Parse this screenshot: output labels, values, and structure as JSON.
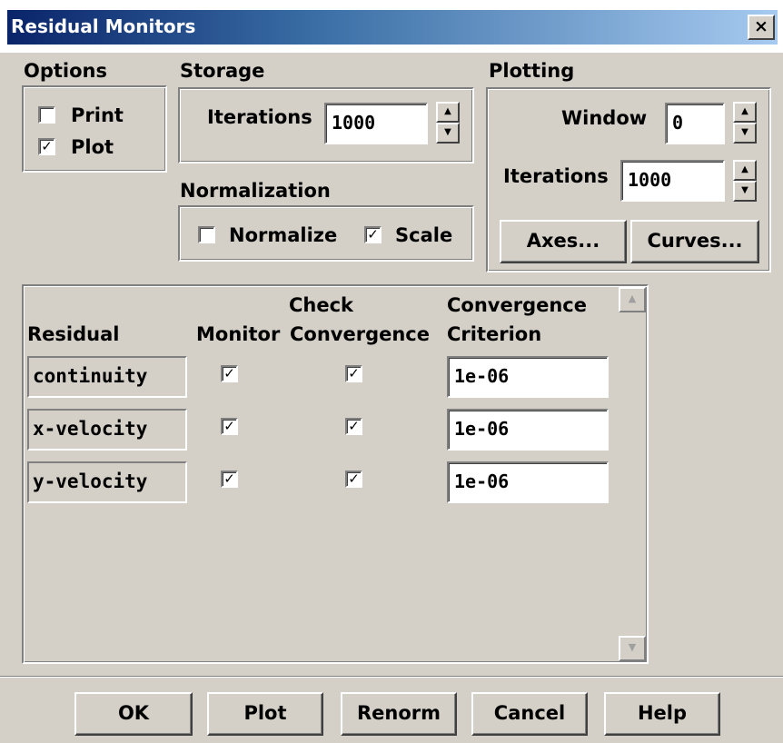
{
  "window": {
    "title": "Residual Monitors",
    "close_glyph": "×"
  },
  "options": {
    "label": "Options",
    "print": {
      "label": "Print",
      "checked": false
    },
    "plot": {
      "label": "Plot",
      "checked": true
    }
  },
  "storage": {
    "label": "Storage",
    "iterations_label": "Iterations",
    "iterations_value": "1000"
  },
  "normalization": {
    "label": "Normalization",
    "normalize": {
      "label": "Normalize",
      "checked": false
    },
    "scale": {
      "label": "Scale",
      "checked": true
    }
  },
  "plotting": {
    "label": "Plotting",
    "window_label": "Window",
    "window_value": "0",
    "iterations_label": "Iterations",
    "iterations_value": "1000",
    "axes_button": "Axes...",
    "curves_button": "Curves..."
  },
  "table": {
    "headers": {
      "residual": "Residual",
      "monitor": "Monitor",
      "check_top": "Check",
      "check_bottom": "Convergence",
      "crit_top": "Convergence",
      "crit_bottom": "Criterion"
    },
    "rows": [
      {
        "name": "continuity",
        "monitor": true,
        "check": true,
        "criterion": "1e-06"
      },
      {
        "name": "x-velocity",
        "monitor": true,
        "check": true,
        "criterion": "1e-06"
      },
      {
        "name": "y-velocity",
        "monitor": true,
        "check": true,
        "criterion": "1e-06"
      }
    ]
  },
  "buttons": {
    "ok": "OK",
    "plot": "Plot",
    "renorm": "Renorm",
    "cancel": "Cancel",
    "help": "Help"
  },
  "glyphs": {
    "check": "✓",
    "spin_up": "▲",
    "spin_down": "▼"
  },
  "icons": {
    "scroll_up": "scroll-up-arrow-icon",
    "scroll_down": "scroll-down-arrow-icon"
  }
}
